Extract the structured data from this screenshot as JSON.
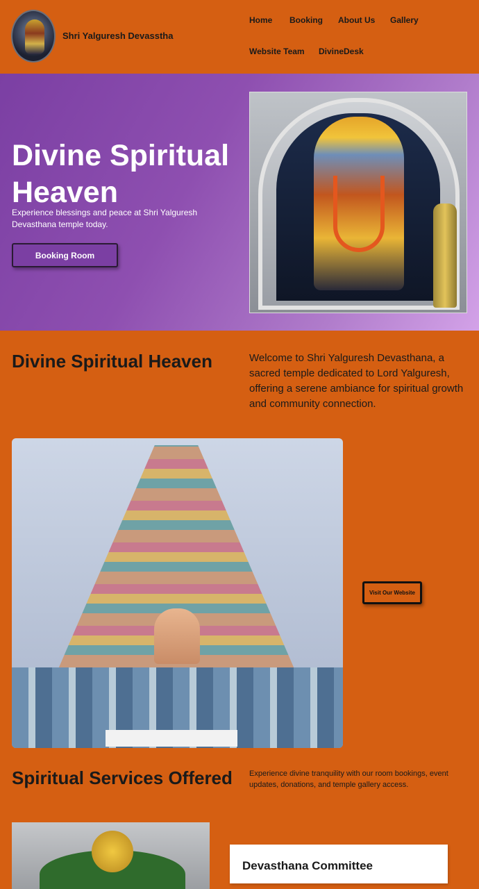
{
  "header": {
    "brand": "Shri Yalguresh Devasstha",
    "nav": {
      "home": "Home",
      "booking": "Booking",
      "about": "About Us",
      "gallery": "Gallery",
      "team": "Website Team",
      "desk": "DivineDesk"
    }
  },
  "hero": {
    "title": "Divine Spiritual Heaven",
    "subtitle": "Experience blessings and peace at Shri Yalguresh Devasthana temple today.",
    "button": "Booking Room"
  },
  "intro": {
    "title": "Divine Spiritual Heaven",
    "text": "Welcome to Shri Yalguresh Devasthana, a sacred temple dedicated to Lord Yalguresh, offering a serene ambiance for spiritual growth and community connection."
  },
  "temple": {
    "button": "Visit Our Website"
  },
  "services": {
    "title": "Spiritual Services Offered",
    "text": "Experience divine tranquility with our room bookings, event updates, donations, and temple gallery access."
  },
  "committee": {
    "title": "Devasthana Committee"
  },
  "colors": {
    "page_bg": "#d55f12",
    "hero_purple": "#7b3fa3",
    "hero_lilac": "#d3a2e8"
  }
}
